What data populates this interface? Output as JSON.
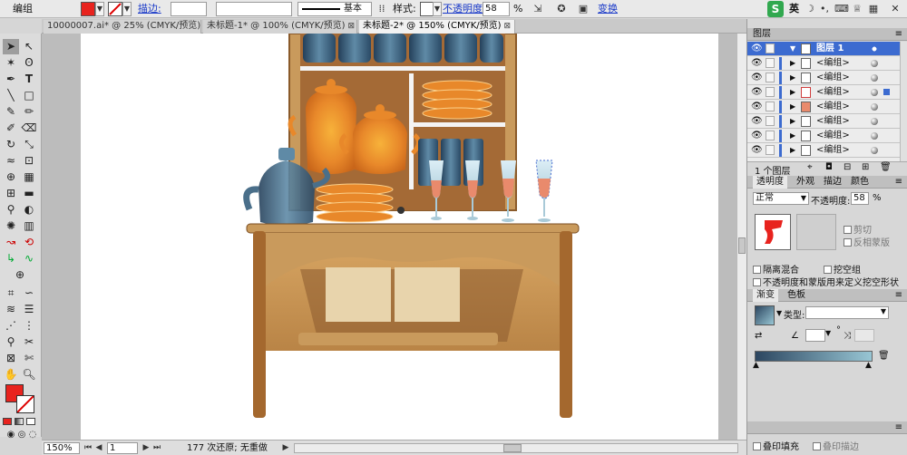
{
  "control_bar": {
    "selection_label": "编组",
    "stroke_label": "描边:",
    "stroke_profile": "基本",
    "style_label": "样式:",
    "opacity_label": "不透明度",
    "opacity_value": "58",
    "opacity_unit": "%",
    "transform_label": "变换",
    "fill_color": "#e8231e",
    "ime_label": "英"
  },
  "tabs": [
    {
      "label": "10000007.ai* @ 25% (CMYK/预览)"
    },
    {
      "label": "未标题-1* @ 100% (CMYK/预览)"
    },
    {
      "label": "未标题-2* @ 150% (CMYK/预览)"
    }
  ],
  "active_tab_index": 2,
  "status": {
    "zoom": "150%",
    "page": "1",
    "message": "177 次还原; 无重做"
  },
  "layers_panel": {
    "title": "图层",
    "rows": [
      {
        "name": "图层 1"
      },
      {
        "name": "<编组>"
      },
      {
        "name": "<编组>"
      },
      {
        "name": "<编组>"
      },
      {
        "name": "<编组>"
      },
      {
        "name": "<编组>"
      },
      {
        "name": "<编组>"
      },
      {
        "name": "<编组>"
      }
    ],
    "footer": "1 个图层"
  },
  "transparency_panel": {
    "tabs": [
      "透明度",
      "外观",
      "描边",
      "颜色"
    ],
    "blend_mode": "正常",
    "opacity_label": "不透明度:",
    "opacity_value": "58",
    "opacity_unit": "%",
    "clip_label": "剪切",
    "invert_mask_label": "反相蒙版",
    "isolate_blend_label": "隔离混合",
    "knockout_group_label": "挖空组",
    "opacity_mask_label": "不透明度和蒙版用来定义挖空形状"
  },
  "gradient_panel": {
    "tabs": [
      "渐变",
      "色板"
    ],
    "type_label": "类型:",
    "angle_unit": "°"
  },
  "attributes_panel": {
    "overprint_fill_label": "叠印填充",
    "overprint_stroke_label": "叠印描边"
  },
  "colors": {
    "layer_accent": "#3c6bd0",
    "gradient_start": "#2c4660",
    "gradient_end": "#98c6d4"
  }
}
